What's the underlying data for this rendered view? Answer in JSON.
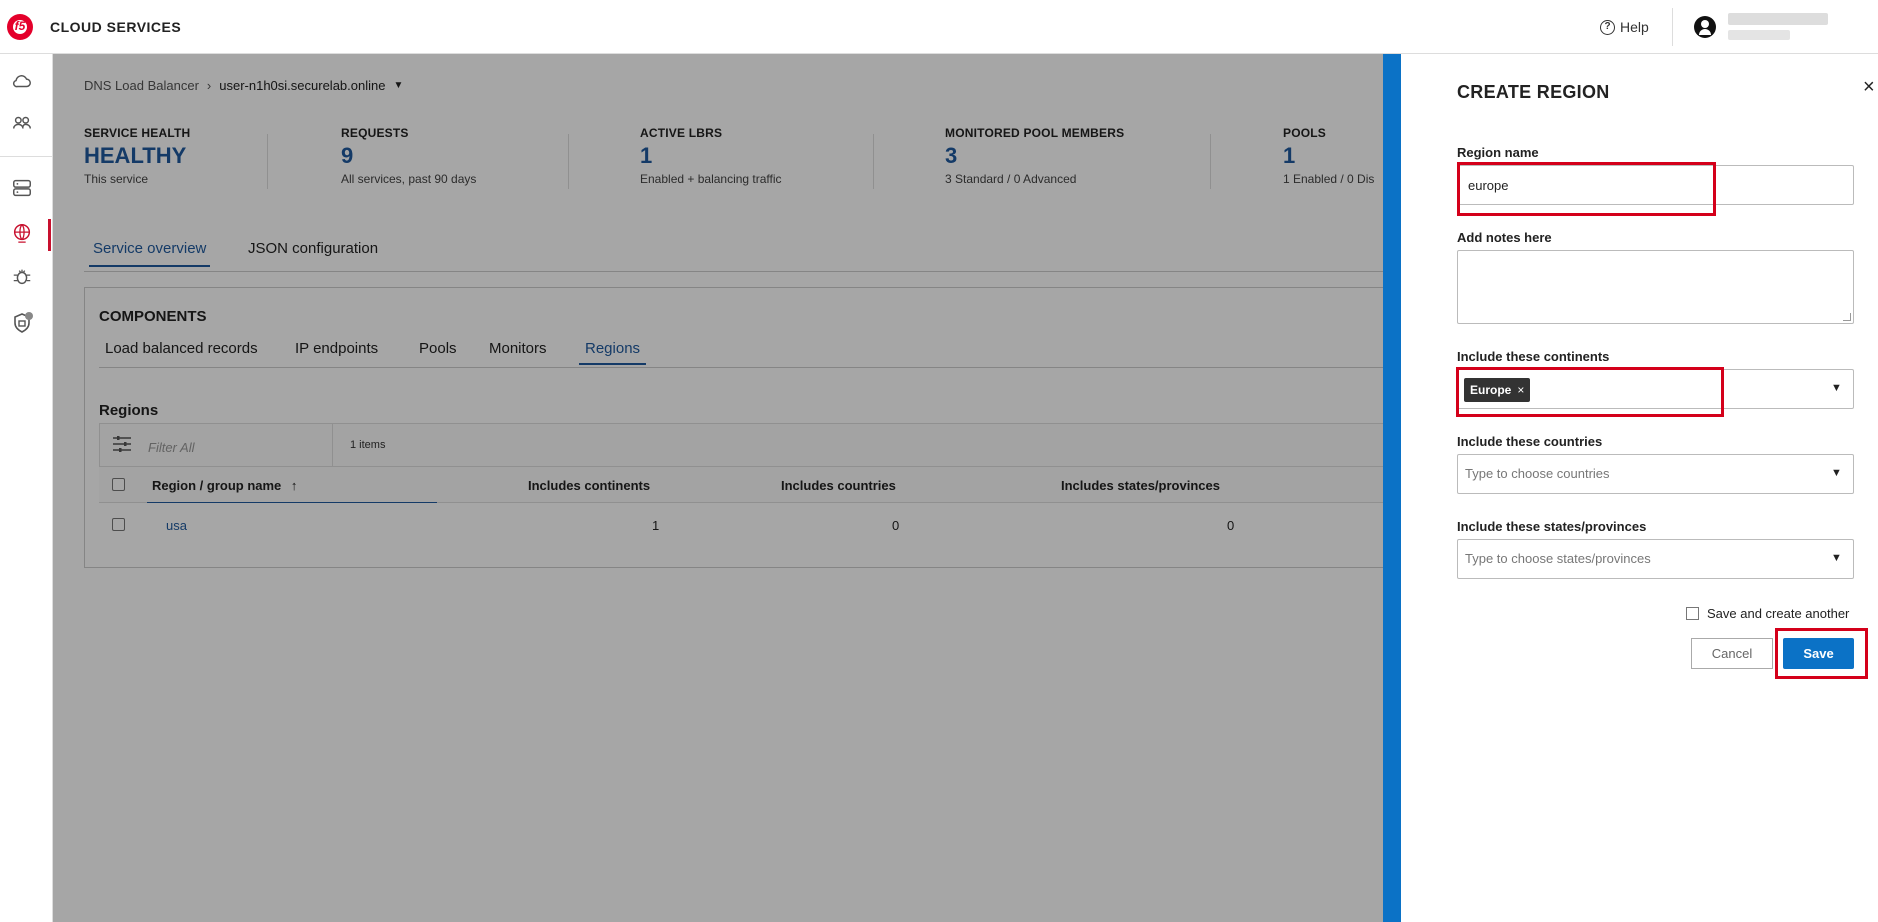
{
  "header": {
    "brand": "CLOUD SERVICES",
    "logo_text": "f5",
    "help_label": "Help"
  },
  "nav": {
    "icons": [
      "cloud-icon",
      "users-icon",
      "server-icon",
      "globe-icon",
      "bug-icon",
      "shield-icon"
    ]
  },
  "breadcrumb": {
    "parent": "DNS Load Balancer",
    "current": "user-n1h0si.securelab.online"
  },
  "stats": [
    {
      "label": "SERVICE HEALTH",
      "value": "HEALTHY",
      "sub": "This service"
    },
    {
      "label": "REQUESTS",
      "value": "9",
      "sub": "All services, past 90 days"
    },
    {
      "label": "ACTIVE LBRS",
      "value": "1",
      "sub": "Enabled + balancing traffic"
    },
    {
      "label": "MONITORED POOL MEMBERS",
      "value": "3",
      "sub": "3 Standard / 0 Advanced"
    },
    {
      "label": "POOLS",
      "value": "1",
      "sub": "1 Enabled / 0 Dis"
    }
  ],
  "tabs": [
    "Service overview",
    "JSON configuration"
  ],
  "components": {
    "title": "COMPONENTS",
    "tabs": [
      "Load balanced records",
      "IP endpoints",
      "Pools",
      "Monitors",
      "Regions"
    ],
    "section_title": "Regions",
    "filter_placeholder": "Filter All",
    "items_count": "1 items",
    "columns": [
      "Region / group name",
      "Includes continents",
      "Includes countries",
      "Includes states/provinces"
    ],
    "sort_arrow": "↑",
    "rows": [
      {
        "name": "usa",
        "continents": "1",
        "countries": "0",
        "states": "0"
      }
    ]
  },
  "drawer": {
    "title": "CREATE REGION",
    "close": "×",
    "region_name_label": "Region name",
    "region_name_value": "europe",
    "notes_label": "Add notes here",
    "continents_label": "Include these continents",
    "continent_chip": "Europe",
    "chip_remove": "×",
    "countries_label": "Include these countries",
    "countries_placeholder": "Type to choose countries",
    "states_label": "Include these states/provinces",
    "states_placeholder": "Type to choose states/provinces",
    "save_another_label": "Save and create another",
    "cancel_label": "Cancel",
    "save_label": "Save"
  },
  "colors": {
    "accent": "#0b72c6",
    "brand_red": "#e4002b",
    "link": "#1f5a9e",
    "highlight": "#d4001a"
  }
}
